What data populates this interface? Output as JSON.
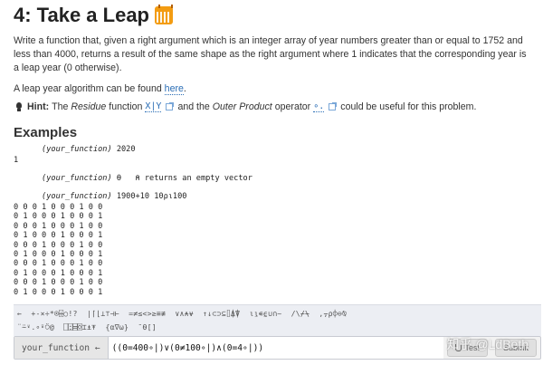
{
  "header": {
    "title": "4: Take a Leap",
    "icon": "calendar-icon"
  },
  "description": {
    "text": "Write a function that, given a right argument which is an integer array of year numbers greater than or equal to 1752 and less than 4000, returns a result of the same shape as the right argument where 1 indicates that the corresponding year is a leap year (0 otherwise).",
    "algorithm_prefix": "A leap year algorithm can be found ",
    "algorithm_link": "here",
    "algorithm_suffix": "."
  },
  "hint": {
    "label": "Hint:",
    "text1": " The ",
    "residue": "Residue",
    "text2": " function ",
    "residue_code": "X|Y",
    "text3": " and the ",
    "outer_product": "Outer Product",
    "text4": " operator ",
    "outer_code": "∘.",
    "text5": " could be useful for this problem."
  },
  "examples": {
    "heading": "Examples",
    "ex1_fn": "(your_function)",
    "ex1_arg": " 2020",
    "ex1_out": "1",
    "ex2_fn": "(your_function)",
    "ex2_arg": " ⍬   ⍝ returns an empty vector",
    "ex3_fn": "(your_function)",
    "ex3_arg": " 1900+10 10⍴⍳100",
    "ex3_out": "0 0 0 1 0 0 0 1 0 0\n0 1 0 0 0 1 0 0 0 1\n0 0 0 1 0 0 0 1 0 0\n0 1 0 0 0 1 0 0 0 1\n0 0 0 1 0 0 0 1 0 0\n0 1 0 0 0 1 0 0 0 1\n0 0 0 1 0 0 0 1 0 0\n0 1 0 0 0 1 0 0 0 1\n0 0 0 1 0 0 0 1 0 0\n0 1 0 0 0 1 0 0 0 1"
  },
  "keyboard": {
    "row1": "←  +-×÷*⍟⌹○!?  |⌈⌊⊥⊤⊣⊢  =≠≤<>≥≡≢  ∨∧⍲⍱  ↑↓⊂⊃⊆⌷⍋⍒  ⍳⍸∊⍷∪∩~  /\\⌿⍀  ,⍪⍴⌽⊖⍉",
    "row2": "¨⍨⍣.∘⍤⍥@  ⎕⍠⌸⌺⌶⍎⍕  {⍺∇⍵}  ¯⍬[]"
  },
  "input": {
    "label": "your_function ←",
    "value": "((0=400∘|)∨(0≠100∘|)∧(0=4∘|))",
    "test_button": "Test",
    "submit_button": "Submit"
  },
  "watermark": "知乎 @LdBeth"
}
